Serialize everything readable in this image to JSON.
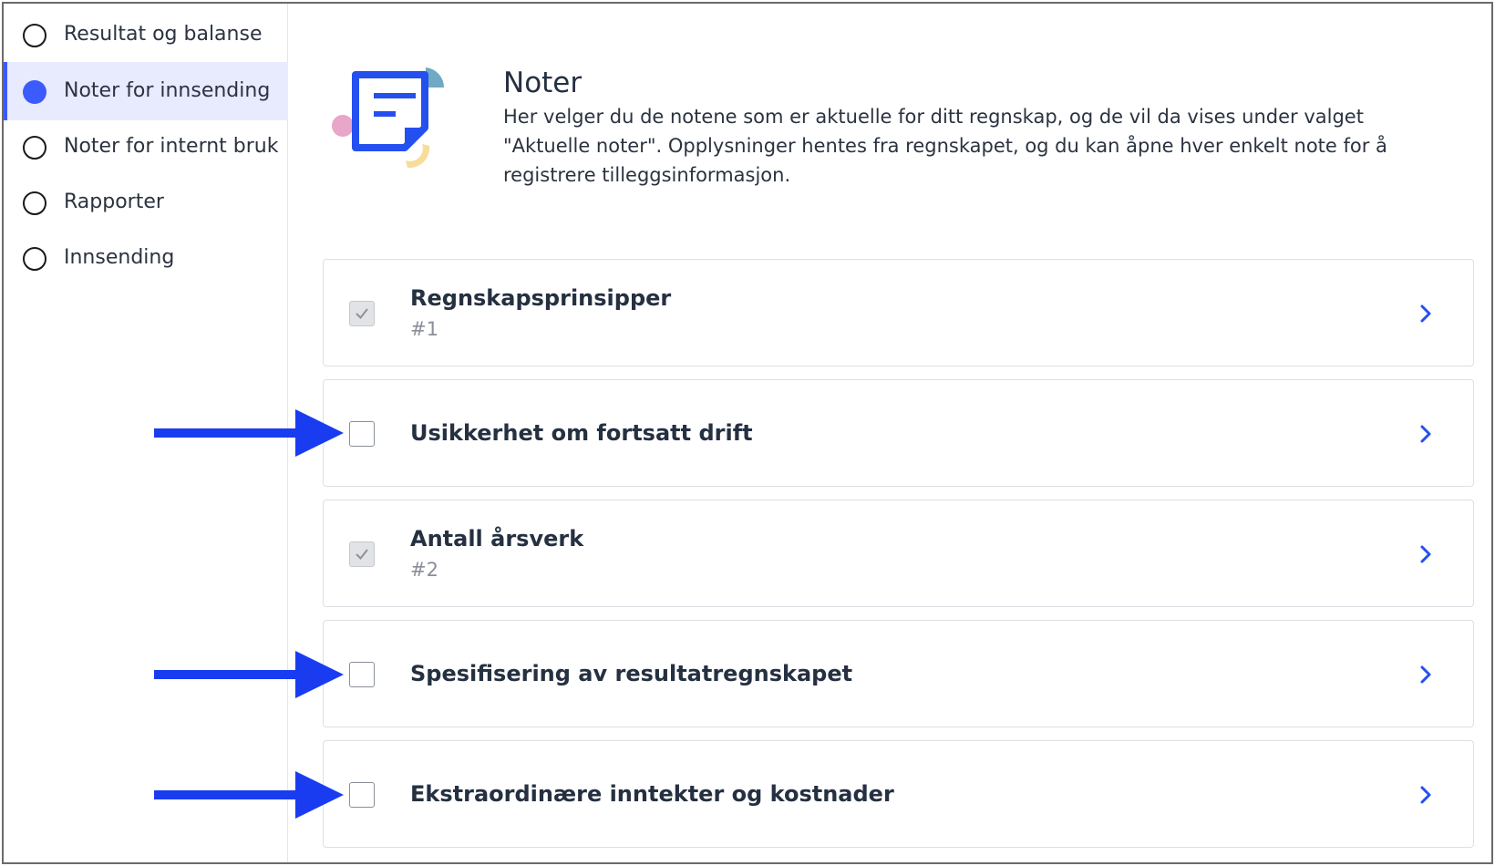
{
  "sidebar": {
    "items": [
      {
        "label": "Resultat og balanse",
        "active": false
      },
      {
        "label": "Noter for innsending",
        "active": true
      },
      {
        "label": "Noter for internt bruk",
        "active": false
      },
      {
        "label": "Rapporter",
        "active": false
      },
      {
        "label": "Innsending",
        "active": false
      }
    ]
  },
  "header": {
    "title": "Noter",
    "description": "Her velger du de notene som er aktuelle for ditt regnskap, og de vil da vises under valget \"Aktuelle noter\". Opplysninger hentes fra regnskapet, og du kan åpne hver enkelt note for å registrere tilleggsinformasjon."
  },
  "notes": [
    {
      "title": "Regnskapsprinsipper",
      "number": "#1",
      "checked": true
    },
    {
      "title": "Usikkerhet om fortsatt drift",
      "number": "",
      "checked": false
    },
    {
      "title": "Antall årsverk",
      "number": "#2",
      "checked": true
    },
    {
      "title": "Spesifisering av resultatregnskapet",
      "number": "",
      "checked": false
    },
    {
      "title": "Ekstraordinære inntekter og kostnader",
      "number": "",
      "checked": false
    }
  ],
  "colors": {
    "accent": "#3b5bfd",
    "annotation_arrow": "#1a3cf0",
    "active_bg": "#e8ebfd"
  }
}
